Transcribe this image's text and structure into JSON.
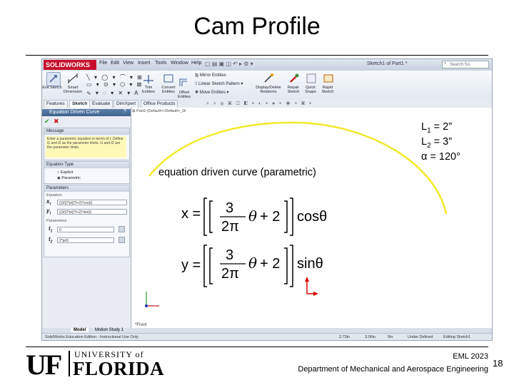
{
  "slide": {
    "title": "Cam Profile",
    "subtitle": "equation driven curve (parametric)",
    "givens": {
      "l1_label": "L",
      "l1_sub": "1",
      "l1_value": " = 2”",
      "l2_label": "L",
      "l2_sub": "2",
      "l2_value": " = 3”",
      "alpha": "α = 120°"
    },
    "equations": {
      "x_lhs": "x =",
      "y_lhs": "y =",
      "frac_num": "3",
      "frac_den": "2π",
      "theta": "θ",
      "plus2": "+ 2",
      "x_trig": "cosθ",
      "y_trig": "sinθ"
    },
    "footer": {
      "logo_uf": "UF",
      "logo_top": "UNIVERSITY of",
      "logo_bottom": "FLORIDA",
      "course": "EML 2023",
      "department": "Department of Mechanical and Aerospace Engineering",
      "page": "18"
    }
  },
  "solidworks": {
    "logo": "SOLIDWORKS",
    "menu": [
      "File",
      "Edit",
      "View",
      "Insert",
      "Tools",
      "Window",
      "Help"
    ],
    "document_title": "Sketch1 of Part1 *",
    "search_placeholder": "Search So",
    "toolbar": {
      "exit_sketch": "Exit Sketch",
      "smart_dimension": "Smart Dimension",
      "trim_entities": "Trim Entities",
      "convert_entities": "Convert Entities",
      "offset_entities": "Offset Entities",
      "mirror_entities": "Mirror Entities",
      "linear_pattern": "Linear Sketch Pattern",
      "move_entities": "Move Entities",
      "display_relations": "Display/Delete Relations",
      "repair_sketch": "Repair Sketch",
      "quick_snaps": "Quick Snaps",
      "rapid_sketch": "Rapid Sketch"
    },
    "command_tabs": [
      "Features",
      "Sketch",
      "Evaluate",
      "DimXpert",
      "Office Products"
    ],
    "active_tab": "Sketch",
    "tree_item": "Part1 (Default<<Default>_Di",
    "property_manager": {
      "title": "Equation Driven Curve",
      "help": "?",
      "ok": "✔",
      "cancel": "✖",
      "message_header": "Message",
      "message_text": "Enter a parametric equation in terms of t. Define t1 and t2 as the parameter limits. t1 and t2 are the parameter limits.",
      "equation_type_header": "Equation Type",
      "type_explicit": "Explicit",
      "type_parametric": "Parametric",
      "parameters_header": "Parameters",
      "equation_label": "Equation",
      "x_label": "x",
      "x_sub": "t",
      "x_expr": "((3/(2*pi))*t+2)*cos(t)",
      "y_label": "y",
      "y_sub": "t",
      "y_expr": "((3/(2*pi))*t+2)*sin(t)",
      "params_label": "Parameters",
      "t1_label": "t",
      "t1_sub": "1",
      "t1_value": "0",
      "t2_label": "t",
      "t2_sub": "2",
      "t2_value": "2*pi/3"
    },
    "view_label": "*Front",
    "model_tabs": [
      "Model",
      "Motion Study 1"
    ],
    "status": {
      "left": "SolidWorks Education Edition - Instructional Use Only",
      "x": "2.73in",
      "y": "3.06in",
      "z": "0in",
      "state": "Under Defined",
      "editing": "Editing Sketch1"
    }
  },
  "colors": {
    "curve": "#f2e92a",
    "sw_red": "#c8102e",
    "uf_blue": "#1a1a1a",
    "axis_red": "#d40000",
    "axis_blue": "#2030c0"
  }
}
